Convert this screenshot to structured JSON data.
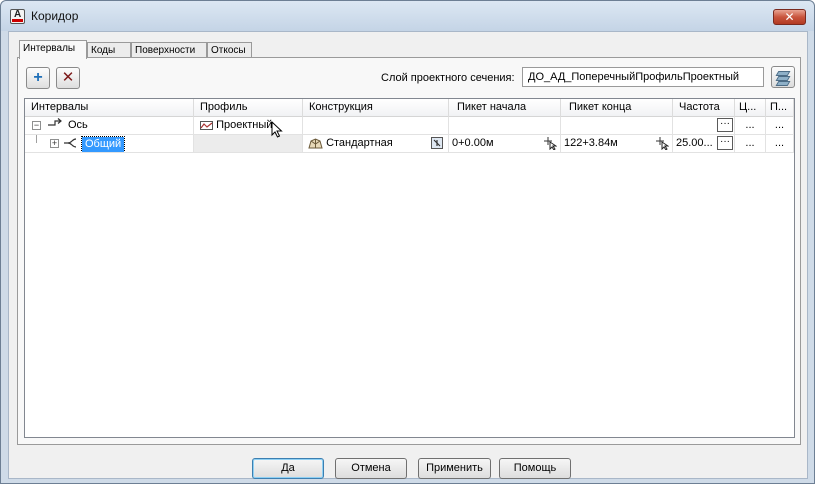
{
  "window": {
    "title": "Коридор",
    "close_label": "✕"
  },
  "tabs": [
    {
      "label": "Интервалы",
      "active": true
    },
    {
      "label": "Коды",
      "active": false
    },
    {
      "label": "Поверхности",
      "active": false
    },
    {
      "label": "Откосы",
      "active": false
    }
  ],
  "toolbar": {
    "add_icon": "plus-icon",
    "delete_icon": "delete-x-icon",
    "layer_label": "Слой проектного сечения:",
    "layer_value": "ДО_АД_ПоперечныйПрофильПроектный",
    "layer_button_icon": "layers-icon"
  },
  "table": {
    "columns": [
      "Интервалы",
      "Профиль",
      "Конструкция",
      "Пикет начала",
      "Пикет конца",
      "Частота",
      "Ц...",
      "П..."
    ],
    "rows": [
      {
        "name": "Ось",
        "expand": "−",
        "icon": "alignment-icon",
        "profile": "Проектный",
        "profile_icon": "profile-icon",
        "assembly": "",
        "start": "",
        "end": "",
        "frequency": "",
        "col7": "...",
        "col8": "..."
      },
      {
        "name": "Общий",
        "expand": "+",
        "icon": "region-icon",
        "profile": "",
        "assembly": "Стандартная",
        "assembly_icon": "assembly-icon",
        "start": "0+0.00м",
        "end": "122+3.84м",
        "frequency": "25.00...",
        "col7": "...",
        "col8": "..."
      }
    ],
    "ellipsis": "···"
  },
  "footer": {
    "ok": "Да",
    "cancel": "Отмена",
    "apply": "Применить",
    "help": "Помощь"
  }
}
